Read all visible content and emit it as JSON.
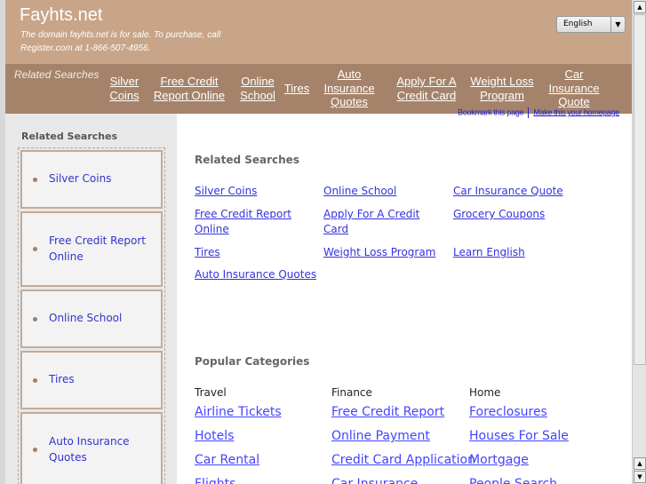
{
  "header": {
    "title": "Fayhts.net",
    "sale_text": "The domain fayhts.net is for sale. To purchase, call Register.com at 1-866-507-4956.",
    "language": "English"
  },
  "nav": {
    "label": "Related Searches",
    "links": [
      "Silver Coins",
      "Free Credit Report Online",
      "Online School",
      "Tires",
      "Auto Insurance Quotes",
      "Apply For A Credit Card",
      "Weight Loss Program",
      "Car Insurance Quote"
    ],
    "bookmark": "Bookmark this page",
    "homepage": "Make this your homepage"
  },
  "sidebar": {
    "title": "Related Searches",
    "items": [
      "Silver Coins",
      "Free Credit Report Online",
      "Online School",
      "Tires",
      "Auto Insurance Quotes"
    ]
  },
  "main": {
    "related_title": "Related Searches",
    "related": [
      "Silver Coins",
      "Online School",
      "Car Insurance Quote",
      "Free Credit Report Online",
      "Apply For A Credit Card",
      "Grocery Coupons",
      "Tires",
      "Weight Loss Program",
      "Learn English",
      "Auto Insurance Quotes"
    ],
    "popular_title": "Popular Categories",
    "categories": [
      {
        "name": "Travel",
        "links": [
          "Airline Tickets",
          "Hotels",
          "Car Rental",
          "Flights"
        ]
      },
      {
        "name": "Finance",
        "links": [
          "Free Credit Report",
          "Online Payment",
          "Credit Card Application",
          "Car Insurance"
        ]
      },
      {
        "name": "Home",
        "links": [
          "Foreclosures",
          "Houses For Sale",
          "Mortgage",
          "People Search"
        ]
      }
    ]
  },
  "colors": {
    "header": "#c8a588",
    "nav": "#a5836a",
    "link": "#3333cc"
  }
}
